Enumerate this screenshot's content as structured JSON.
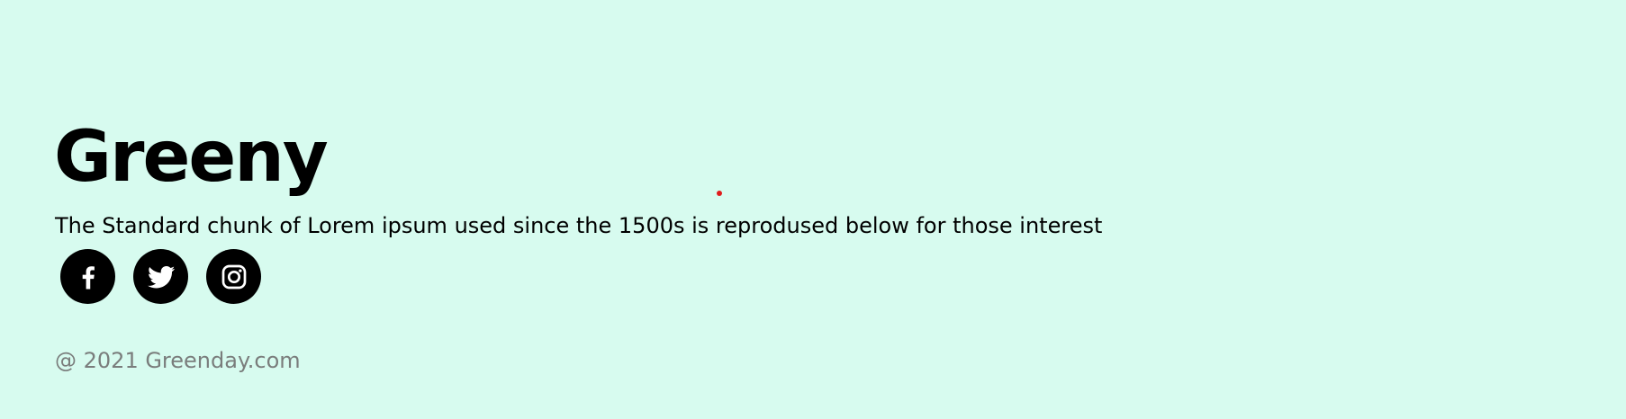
{
  "footer": {
    "brand": "Greeny",
    "tagline": "The Standard chunk of Lorem ipsum used since the 1500s is reprodused below for those interest",
    "copyright": "@ 2021 Greenday.com",
    "social_links": [
      {
        "name": "facebook",
        "icon": "facebook-icon"
      },
      {
        "name": "twitter",
        "icon": "twitter-icon"
      },
      {
        "name": "instagram",
        "icon": "instagram-icon"
      }
    ]
  },
  "colors": {
    "background": "#d7fbef",
    "text": "#000000",
    "muted_text": "#7a7d7c",
    "cursor_marker": "#e01b1b"
  }
}
